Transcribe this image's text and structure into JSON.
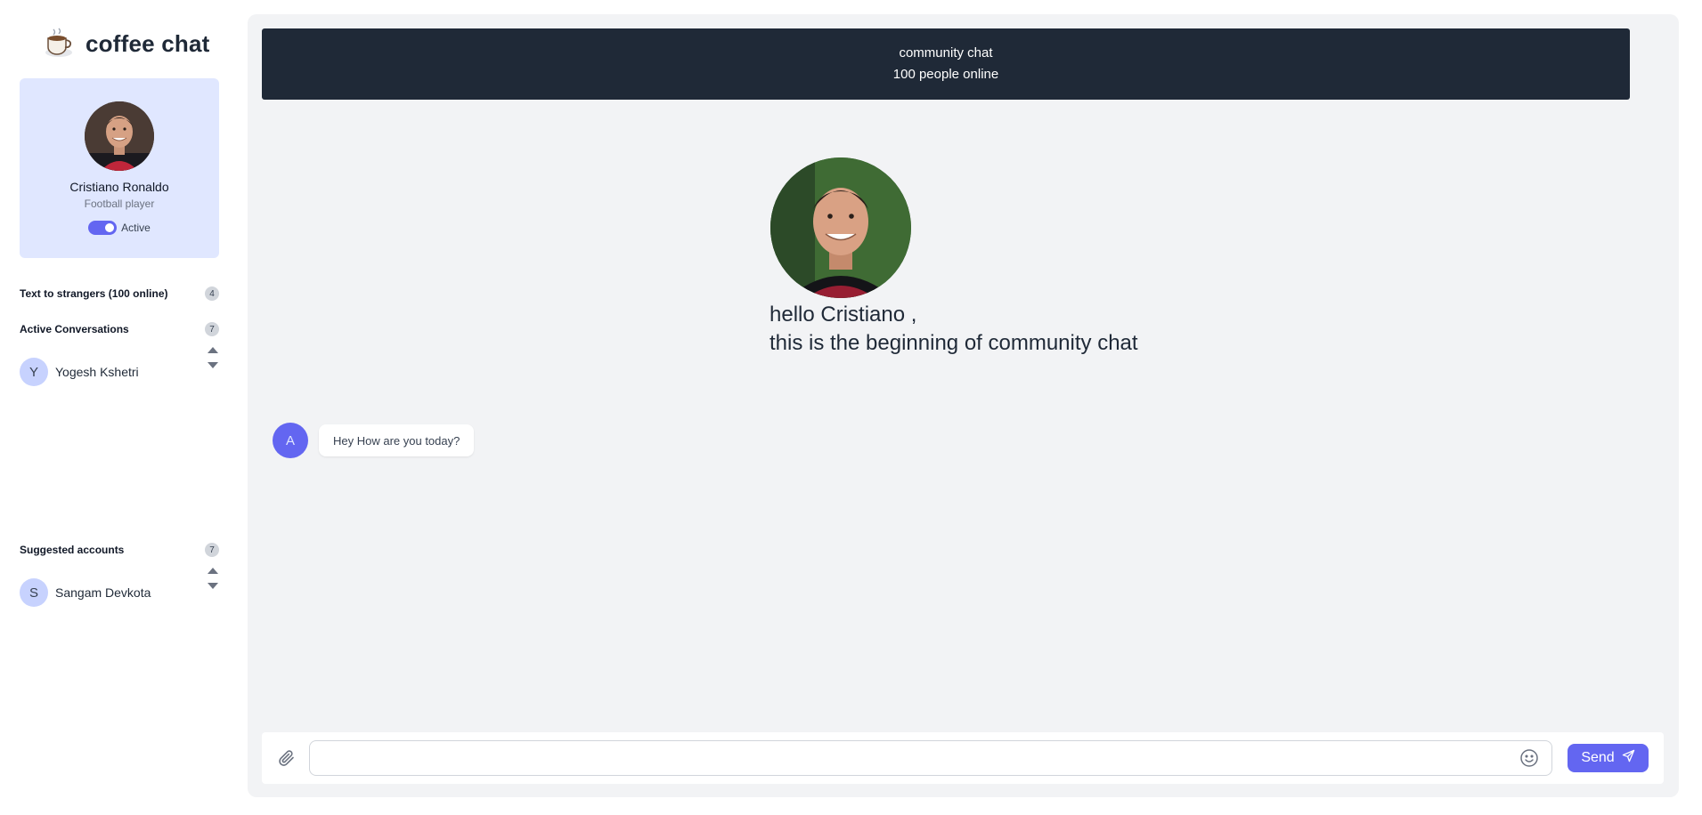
{
  "app": {
    "name": "coffee chat",
    "logo_icon": "coffee-cup-icon"
  },
  "profile": {
    "name": "Cristiano Ronaldo",
    "role": "Football player",
    "status_label": "Active",
    "status_on": true
  },
  "sidebar": {
    "strangers": {
      "label": "Text to strangers (100 online)",
      "count": "4"
    },
    "active_conversations": {
      "label": "Active Conversations",
      "count": "7",
      "items": [
        {
          "initial": "Y",
          "name": "Yogesh Kshetri"
        }
      ]
    },
    "suggested": {
      "label": "Suggested accounts",
      "count": "7",
      "items": [
        {
          "initial": "S",
          "name": "Sangam Devkota"
        }
      ]
    }
  },
  "chat": {
    "header_title": "community chat",
    "header_subtitle": "100 people online",
    "intro_line1": "hello Cristiano ,",
    "intro_line2": "this is the beginning of community chat",
    "messages": [
      {
        "initial": "A",
        "text": "Hey How are you today?"
      }
    ]
  },
  "composer": {
    "input_value": "",
    "input_placeholder": "",
    "send_label": "Send",
    "attach_icon": "paperclip-icon",
    "emoji_icon": "smiley-icon",
    "send_icon": "paper-plane-icon"
  },
  "colors": {
    "accent": "#6366f1",
    "header_bg": "#1f2937",
    "profile_card_bg": "#e0e7ff",
    "main_bg": "#f2f3f5"
  }
}
